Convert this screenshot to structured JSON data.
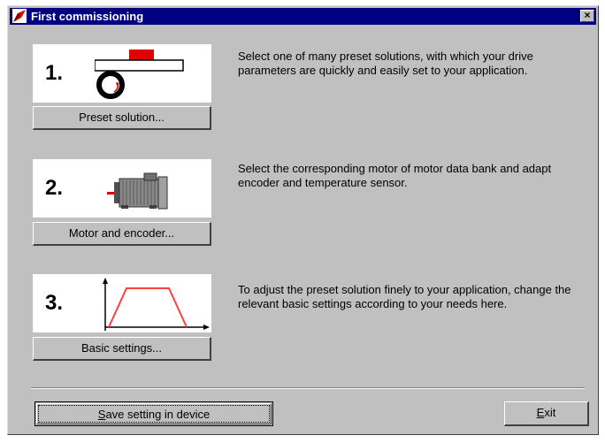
{
  "window": {
    "title": "First commissioning",
    "close_symbol": "×"
  },
  "steps": [
    {
      "number": "1.",
      "button_label": "Preset solution...",
      "description": "Select one of many preset solutions, with which your drive parameters are quickly and easily set to your application.",
      "icon": "preset-solution-icon"
    },
    {
      "number": "2.",
      "button_label": "Motor and encoder...",
      "description": "Select the corresponding motor of motor data bank and adapt encoder and temperature sensor.",
      "icon": "motor-icon"
    },
    {
      "number": "3.",
      "button_label": "Basic settings...",
      "description": "To adjust the preset solution finely to your application, change the relevant basic settings according to your needs here.",
      "icon": "profile-graph-icon"
    }
  ],
  "footer": {
    "save_label_mnemonic": "S",
    "save_label_rest": "ave setting in device",
    "exit_label_mnemonic": "E",
    "exit_label_rest": "xit"
  },
  "colors": {
    "titlebar": "#000080",
    "face": "#c0c0c0",
    "accent_red": "#e00000",
    "profile_red": "#ff4040"
  }
}
